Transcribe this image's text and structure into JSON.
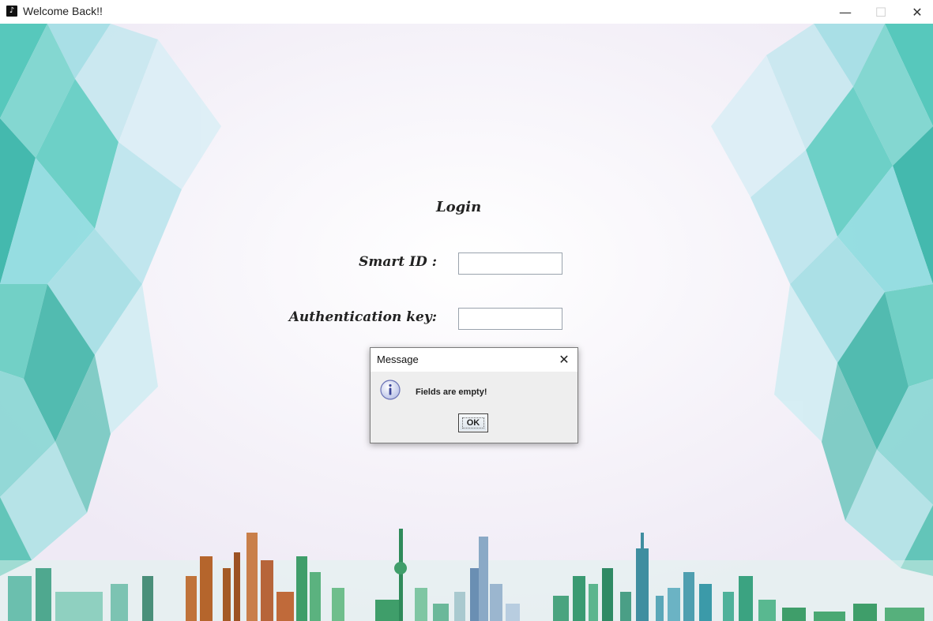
{
  "window": {
    "title": "Welcome Back!!",
    "minimize_glyph": "—",
    "maximize_glyph": "☐",
    "close_glyph": "✕"
  },
  "login": {
    "heading": "Login",
    "smart_id_label": "Smart ID :",
    "smart_id_value": "",
    "auth_key_label": "Authentication key:",
    "auth_key_value": ""
  },
  "dialog": {
    "title": "Message",
    "close_glyph": "✕",
    "message": "Fields are empty!",
    "ok_label": "OK",
    "icon": "info-icon"
  },
  "colors": {
    "crystal_teal": "#5fd3c9",
    "crystal_blue": "#8ecbe6",
    "skyline_green": "#3f9e6a",
    "skyline_brown": "#b5652c"
  }
}
